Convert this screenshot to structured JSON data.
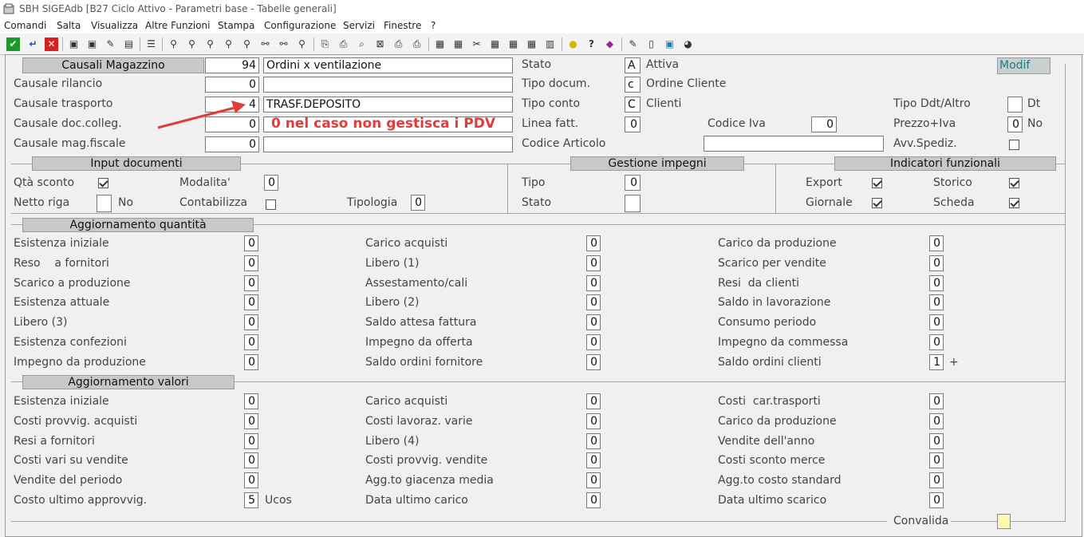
{
  "window": {
    "title": "SBH SIGEAdb [B27 Ciclo Attivo - Parametri base - Tabelle generali]"
  },
  "menu": [
    "Comandi",
    "Salta",
    "Visualizza",
    "Altre Funzioni",
    "Stampa",
    "Configurazione",
    "Servizi",
    "Finestre",
    "?"
  ],
  "header": {
    "causali_magazzino": {
      "label": "Causali Magazzino",
      "value": "94",
      "desc": "Ordini x ventilazione"
    },
    "causale_rilancio": {
      "label": "Causale rilancio",
      "value": "0",
      "desc": ""
    },
    "causale_trasporto": {
      "label": "Causale trasporto",
      "value": "4",
      "desc": "TRASF.DEPOSITO"
    },
    "causale_doc_colleg": {
      "label": "Causale doc.colleg.",
      "value": "0",
      "desc": "0 nel caso non gestisca i PDV"
    },
    "causale_mag_fiscale": {
      "label": "Causale mag.fiscale",
      "value": "0",
      "desc": ""
    },
    "stato": {
      "label": "Stato",
      "code": "A",
      "desc": "Attiva"
    },
    "tipo_docum": {
      "label": "Tipo docum.",
      "code": "c",
      "desc": "Ordine Cliente"
    },
    "tipo_conto": {
      "label": "Tipo conto",
      "code": "C",
      "desc": "Clienti"
    },
    "linea_fatt": {
      "label": "Linea fatt.",
      "value": "0"
    },
    "codice_articolo": {
      "label": "Codice Articolo",
      "value": ""
    },
    "codice_iva": {
      "label": "Codice Iva",
      "value": "0"
    },
    "tipo_ddt": {
      "label": "Tipo Ddt/Altro",
      "value": "",
      "desc": "Dt"
    },
    "prezzo_iva": {
      "label": "Prezzo+Iva",
      "value": "0",
      "desc": "No"
    },
    "avv_spediz": {
      "label": "Avv.Spediz.",
      "checked": false
    },
    "modif": "Modif"
  },
  "input_documenti": {
    "title": "Input documenti",
    "qta_sconto": {
      "label": "Qtà sconto",
      "checked": true
    },
    "modalita": {
      "label": "Modalita'",
      "value": "0"
    },
    "netto_riga": {
      "label": "Netto riga",
      "value": "",
      "desc": "No"
    },
    "contabilizza": {
      "label": "Contabilizza",
      "checked": false
    },
    "tipologia": {
      "label": "Tipologia",
      "value": "0"
    }
  },
  "gestione_impegni": {
    "title": "Gestione impegni",
    "tipo": {
      "label": "Tipo",
      "value": "0"
    },
    "stato": {
      "label": "Stato",
      "value": ""
    }
  },
  "indicatori": {
    "title": "Indicatori funzionali",
    "export": {
      "label": "Export",
      "checked": true
    },
    "storico": {
      "label": "Storico",
      "checked": true
    },
    "giornale": {
      "label": "Giornale",
      "checked": true
    },
    "scheda": {
      "label": "Scheda",
      "checked": true
    }
  },
  "agg_quantita": {
    "title": "Aggiornamento quantità",
    "col1": [
      {
        "label": "Esistenza iniziale",
        "value": "0"
      },
      {
        "label": "Reso    a fornitori",
        "value": "0"
      },
      {
        "label": "Scarico a produzione",
        "value": "0"
      },
      {
        "label": "Esistenza attuale",
        "value": "0"
      },
      {
        "label": "Libero (3)",
        "value": "0"
      },
      {
        "label": "Esistenza confezioni",
        "value": "0"
      },
      {
        "label": "Impegno da produzione",
        "value": "0"
      }
    ],
    "col2": [
      {
        "label": "Carico acquisti",
        "value": "0"
      },
      {
        "label": "Libero (1)",
        "value": "0"
      },
      {
        "label": "Assestamento/cali",
        "value": "0"
      },
      {
        "label": "Libero (2)",
        "value": "0"
      },
      {
        "label": "Saldo attesa fattura",
        "value": "0"
      },
      {
        "label": "Impegno da offerta",
        "value": "0"
      },
      {
        "label": "Saldo ordini fornitore",
        "value": "0"
      }
    ],
    "col3": [
      {
        "label": "Carico da produzione",
        "value": "0"
      },
      {
        "label": "Scarico per vendite",
        "value": "0"
      },
      {
        "label": "Resi  da clienti",
        "value": "0"
      },
      {
        "label": "Saldo in lavorazione",
        "value": "0"
      },
      {
        "label": "Consumo periodo",
        "value": "0"
      },
      {
        "label": "Impegno da commessa",
        "value": "0"
      },
      {
        "label": "Saldo ordini clienti",
        "value": "1",
        "extra": "+"
      }
    ]
  },
  "agg_valori": {
    "title": "Aggiornamento valori",
    "col1": [
      {
        "label": "Esistenza iniziale",
        "value": "0"
      },
      {
        "label": "Costi provvig. acquisti",
        "value": "0"
      },
      {
        "label": "Resi a fornitori",
        "value": "0"
      },
      {
        "label": "Costi vari su vendite",
        "value": "0"
      },
      {
        "label": "Vendite del periodo",
        "value": "0"
      },
      {
        "label": "Costo ultimo approvvig.",
        "value": "5",
        "extra": "Ucos"
      }
    ],
    "col2": [
      {
        "label": "Carico acquisti",
        "value": "0"
      },
      {
        "label": "Costi lavoraz. varie",
        "value": "0"
      },
      {
        "label": "Libero (4)",
        "value": "0"
      },
      {
        "label": "Costi provvig. vendite",
        "value": "0"
      },
      {
        "label": "Agg.to giacenza media",
        "value": "0"
      },
      {
        "label": "Data ultimo carico",
        "value": "0"
      }
    ],
    "col3": [
      {
        "label": "Costi  car.trasporti",
        "value": "0"
      },
      {
        "label": "Carico da produzione",
        "value": "0"
      },
      {
        "label": "Vendite dell'anno",
        "value": "0"
      },
      {
        "label": "Costi sconto merce",
        "value": "0"
      },
      {
        "label": "Agg.to costo standard",
        "value": "0"
      },
      {
        "label": "Data ultimo scarico",
        "value": "0"
      }
    ]
  },
  "convalida": {
    "label": "Convalida"
  },
  "colors": {
    "annotation": "#e03c3c",
    "modif_text": "#1d7d7d",
    "convalida_box": "#fff8b0"
  }
}
